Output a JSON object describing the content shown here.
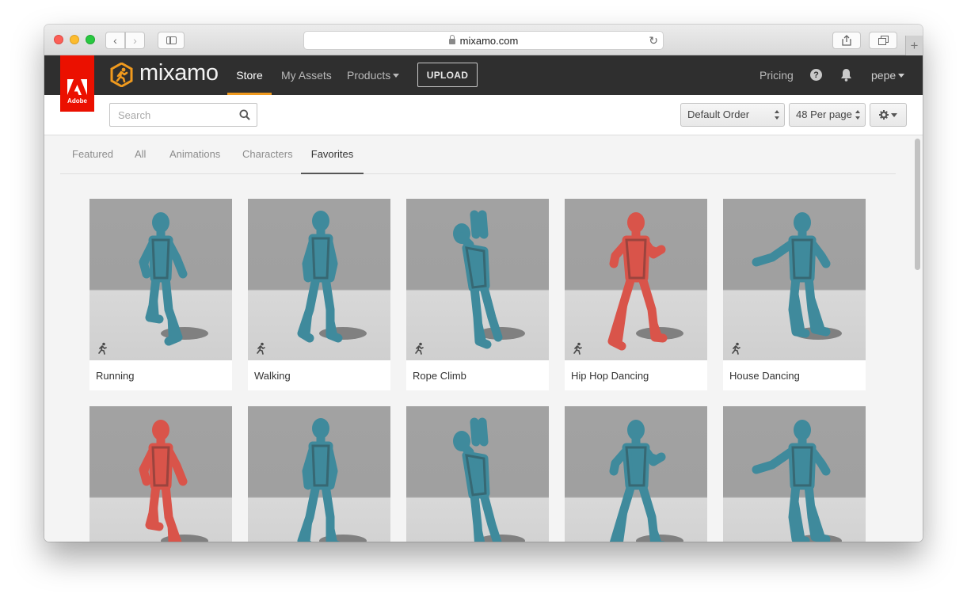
{
  "browser": {
    "url": "mixamo.com",
    "new_tab_symbol": "+"
  },
  "brand": {
    "adobe_label": "Adobe",
    "logo_text": "mixamo",
    "accent_color": "#f09a1e",
    "adobe_red": "#eb1000"
  },
  "nav": {
    "store": "Store",
    "my_assets": "My Assets",
    "products": "Products",
    "upload": "UPLOAD",
    "pricing": "Pricing",
    "help": "?",
    "user": "pepe"
  },
  "filters": {
    "search_placeholder": "Search",
    "order_selected": "Default Order",
    "per_page_selected": "48 Per page"
  },
  "tabs": {
    "featured": "Featured",
    "all": "All",
    "animations": "Animations",
    "characters": "Characters",
    "favorites": "Favorites",
    "active": "Favorites"
  },
  "animations": [
    {
      "name": "Running",
      "color": "#3f8a9c"
    },
    {
      "name": "Walking",
      "color": "#3f8a9c"
    },
    {
      "name": "Rope Climb",
      "color": "#3f8a9c"
    },
    {
      "name": "Hip Hop Dancing",
      "color": "#d9544a"
    },
    {
      "name": "House Dancing",
      "color": "#3f8a9c"
    },
    {
      "name": "",
      "color": "#d9544a"
    },
    {
      "name": "",
      "color": "#3f8a9c"
    },
    {
      "name": "",
      "color": "#3f8a9c"
    },
    {
      "name": "",
      "color": "#3f8a9c"
    },
    {
      "name": "",
      "color": "#3f8a9c"
    }
  ]
}
